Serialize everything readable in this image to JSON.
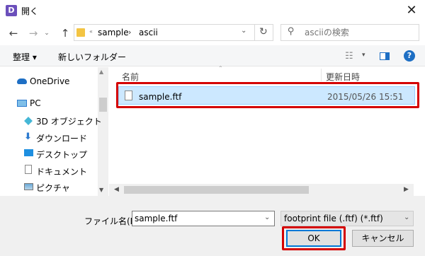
{
  "window": {
    "title": "開く",
    "app_icon_letter": "D",
    "close_glyph": "✕"
  },
  "nav": {
    "back_glyph": "←",
    "forward_glyph": "→",
    "recent_glyph": "⌄",
    "up_glyph": "↑",
    "path": [
      "sample",
      "ascii"
    ],
    "path_separator": "›",
    "overflow_glyph": "«",
    "dropdown_glyph": "⌄",
    "refresh_glyph": "↻",
    "search_placeholder": "asciiの検索",
    "search_glyph": "⚲"
  },
  "toolbar": {
    "organize": "整理 ▾",
    "new_folder": "新しいフォルダー",
    "view_glyph": "☷",
    "view_dropdown_glyph": "▾",
    "help_glyph": "?"
  },
  "sidebar": {
    "items": [
      {
        "label": "OneDrive",
        "icon": "cloud-icon"
      },
      {
        "label": "PC",
        "icon": "computer-icon"
      },
      {
        "label": "3D オブジェクト",
        "icon": "cube-icon"
      },
      {
        "label": "ダウンロード",
        "icon": "download-icon"
      },
      {
        "label": "デスクトップ",
        "icon": "desktop-icon"
      },
      {
        "label": "ドキュメント",
        "icon": "document-icon"
      },
      {
        "label": "ピクチャ",
        "icon": "picture-icon"
      }
    ],
    "scroll_up_glyph": "▲",
    "scroll_down_glyph": "▼",
    "download_glyph": "⬇"
  },
  "file_list": {
    "columns": {
      "name": "名前",
      "date": "更新日時"
    },
    "sort_glyph": "⌃",
    "rows": [
      {
        "name": "sample.ftf",
        "date": "2015/05/26 15:51",
        "selected": true
      }
    ],
    "scroll_left_glyph": "◀",
    "scroll_right_glyph": "▶"
  },
  "footer": {
    "filename_label": "ファイル名(N):",
    "filename_value": "sample.ftf",
    "dropdown_glyph": "⌄",
    "filetype": "footprint file (.ftf) (*.ftf)",
    "ok": "OK",
    "cancel": "キャンセル"
  },
  "colors": {
    "accent": "#0078d7",
    "selection_bg": "#cce8ff",
    "annotation_red": "#d40000"
  }
}
